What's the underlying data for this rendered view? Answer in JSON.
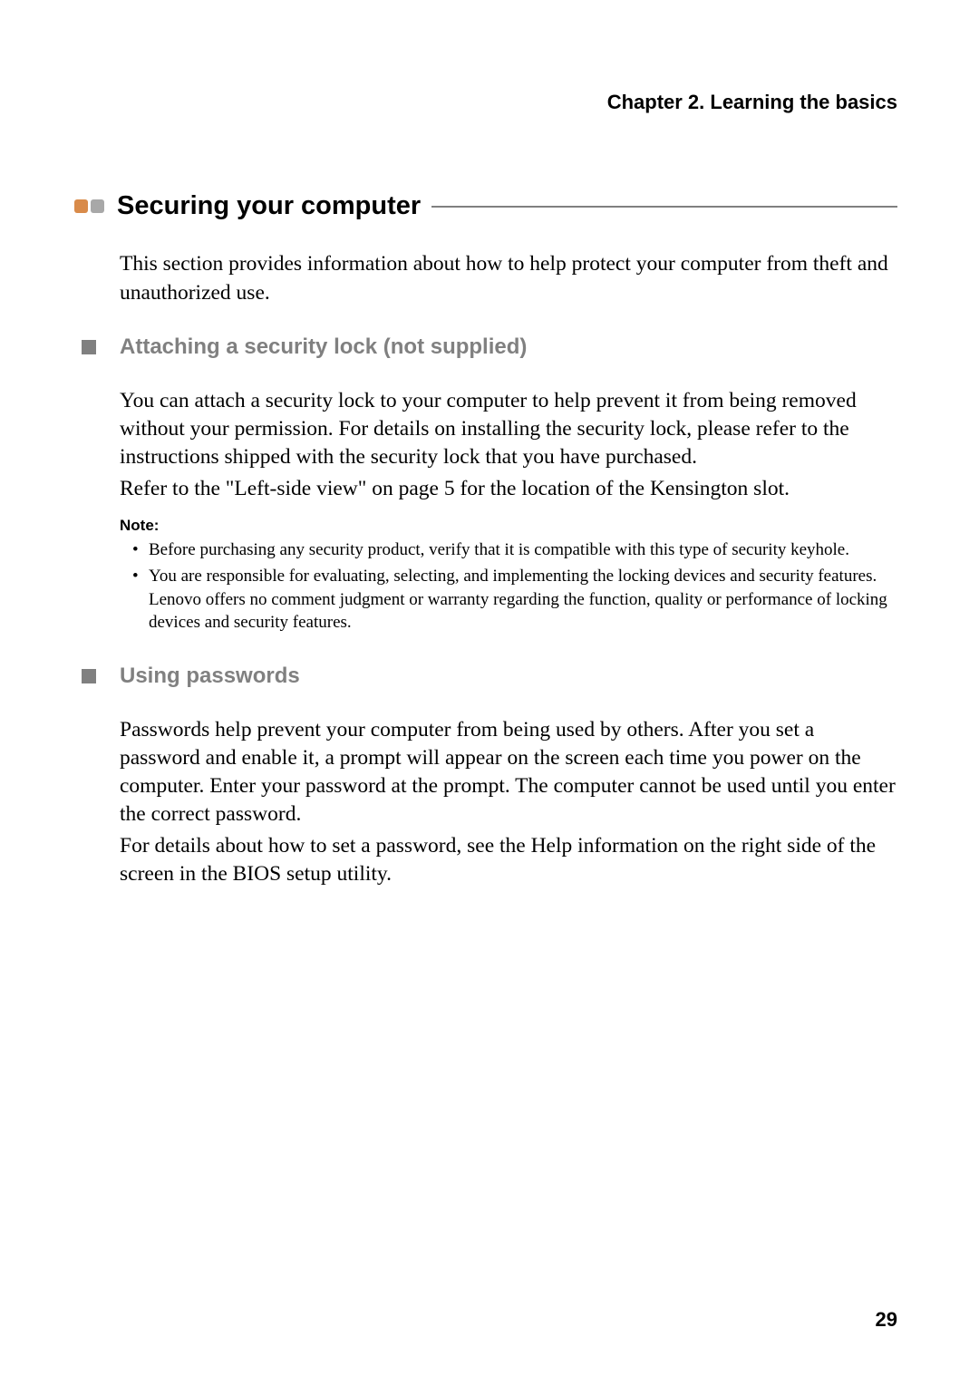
{
  "chapter_header": "Chapter 2. Learning the basics",
  "main_heading": "Securing your computer",
  "intro": "This section provides information about how to help protect your computer from theft and unauthorized use.",
  "section1": {
    "heading": "Attaching a security lock (not supplied)",
    "para1": "You can attach a security lock to your computer to help prevent it from being removed without your permission. For details on installing the security lock, please refer to the instructions shipped with the security lock that you have purchased.",
    "para2": "Refer to the \"Left-side view\" on page 5 for the location of the Kensington slot."
  },
  "note": {
    "label": "Note:",
    "items": [
      "Before purchasing any security product, verify that it is compatible with this type of security keyhole.",
      "You are responsible for evaluating, selecting, and implementing the locking devices and security features. Lenovo offers no comment judgment or warranty regarding the function, quality or performance of locking devices and security features."
    ]
  },
  "section2": {
    "heading": "Using passwords",
    "para1": "Passwords help prevent your computer from being used by others. After you set a password and enable it, a prompt will appear on the screen each time you power on the computer. Enter your password at the prompt. The computer cannot be used until you enter the correct password.",
    "para2": "For details about how to set a password, see the Help information on the right side of the screen in the BIOS setup utility."
  },
  "page_number": "29"
}
